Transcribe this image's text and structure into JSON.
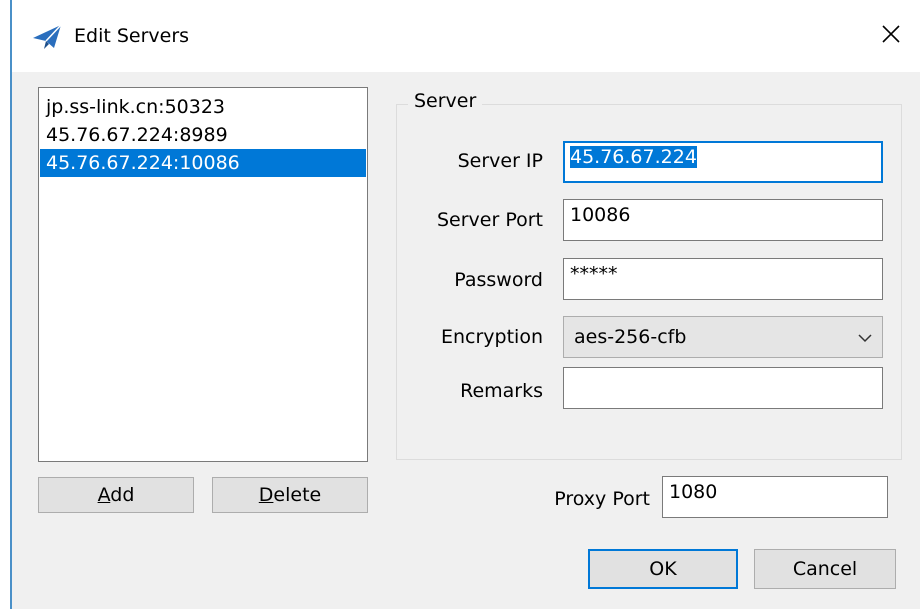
{
  "window": {
    "title": "Edit Servers",
    "close_glyph": "✕"
  },
  "servers": [
    {
      "label": "jp.ss-link.cn:50323",
      "selected": false
    },
    {
      "label": "45.76.67.224:8989",
      "selected": false
    },
    {
      "label": "45.76.67.224:10086",
      "selected": true
    }
  ],
  "buttons": {
    "add": {
      "accel": "A",
      "rest": "dd"
    },
    "delete": {
      "accel": "D",
      "rest": "elete"
    },
    "ok": "OK",
    "cancel": "Cancel"
  },
  "server_group": {
    "legend": "Server",
    "server_ip_label": "Server IP",
    "server_ip_value": "45.76.67.224",
    "server_port_label": "Server Port",
    "server_port_value": "10086",
    "password_label": "Password",
    "password_value": "*****",
    "encryption_label": "Encryption",
    "encryption_value": "aes-256-cfb",
    "remarks_label": "Remarks",
    "remarks_value": ""
  },
  "proxy": {
    "label": "Proxy Port",
    "value": "1080"
  },
  "colors": {
    "accent": "#0078d7",
    "icon": "#2a6ebd"
  },
  "icons": {
    "app": "paper-plane-icon",
    "close": "close-icon",
    "dropdown": "chevron-down-icon"
  }
}
